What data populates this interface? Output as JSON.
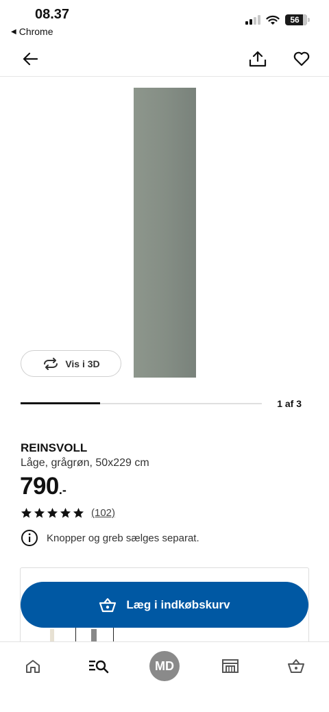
{
  "status_bar": {
    "time": "08.37",
    "back_app": "Chrome",
    "battery_level": "56"
  },
  "icons": {
    "back": "arrow-left-icon",
    "share": "share-icon",
    "favorite": "heart-icon",
    "view3d": "rotate-icon",
    "info": "info-icon",
    "cart": "basket-icon",
    "home": "home-icon",
    "search": "search-list-icon",
    "store": "store-icon",
    "basket": "basket-icon"
  },
  "gallery": {
    "view_3d_label": "Vis i 3D",
    "counter": "1 af 3",
    "progress": 0.33
  },
  "product": {
    "name": "REINSVOLL",
    "description": "Låge, grågrøn, 50x229 cm",
    "price_int": "790",
    "price_suffix": ".-",
    "rating": 5,
    "review_count": "(102)",
    "notice": "Knopper og greb sælges separat."
  },
  "cta": {
    "add_to_cart_label": "Læg i indkøbskurv"
  },
  "bottom_nav": {
    "avatar_initials": "MD"
  },
  "colors": {
    "primary_blue": "#0058a3",
    "product_color": "#858e85"
  }
}
